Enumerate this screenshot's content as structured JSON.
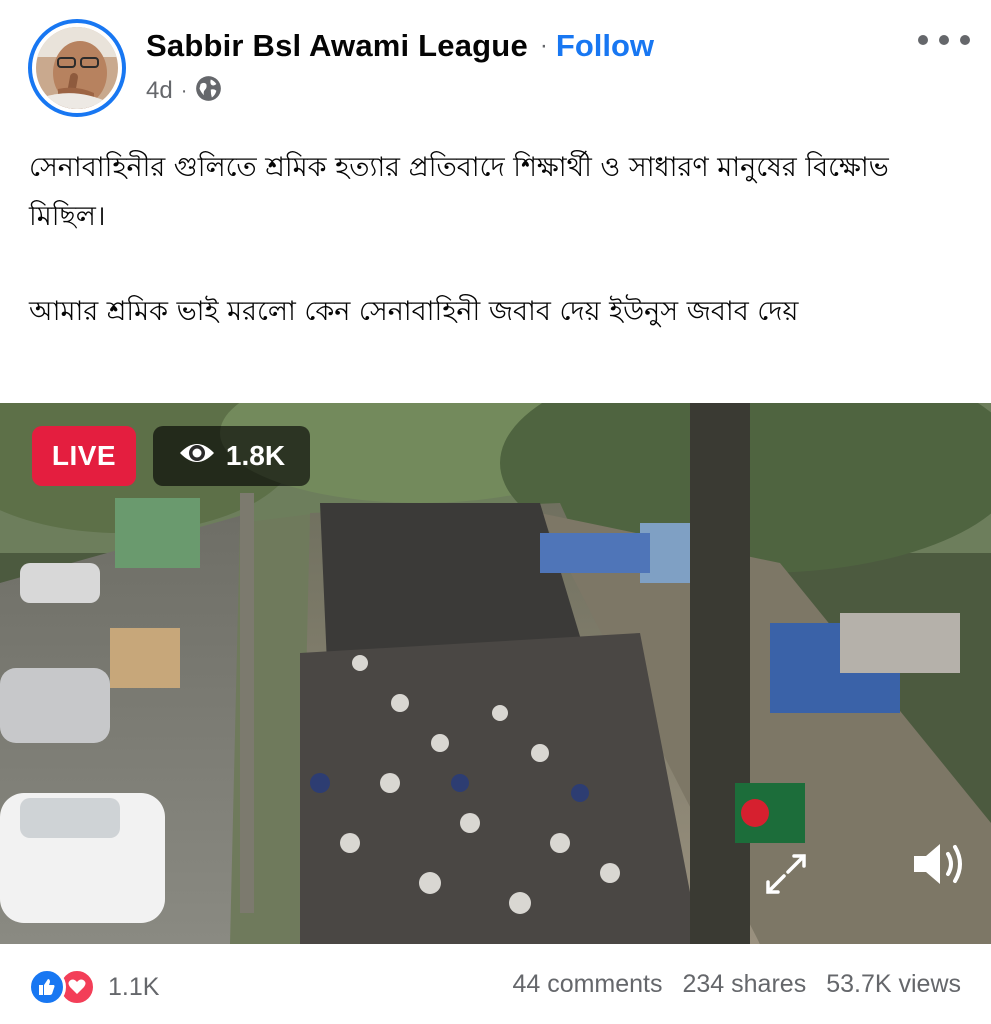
{
  "post": {
    "author": "Sabbir Bsl Awami League",
    "separator": "·",
    "follow_label": "Follow",
    "time": "4d",
    "meta_dot": "·",
    "privacy_icon": "globe-icon",
    "more_icon": "more-horizontal-icon"
  },
  "caption": {
    "line1": "সেনাবাহিনীর গুলিতে শ্রমিক হত্যার প্রতিবাদে  শিক্ষার্থী ও সাধারণ মানুষের বিক্ষোভ মিছিল।",
    "line2": "আমার শ্রমিক ভাই মরলো কেন সেনাবাহিনী জবাব দেয় ইউনুস জবাব দেয়"
  },
  "video": {
    "live_label": "LIVE",
    "viewers": "1.8K",
    "viewer_icon": "eye-icon",
    "sound_icon": "volume-icon",
    "expand_icon": "expand-icon"
  },
  "footer": {
    "reaction_icons": [
      "like-icon",
      "love-icon"
    ],
    "reaction_count": "1.1K",
    "comments": "44 comments",
    "shares": "234 shares",
    "views": "53.7K views"
  },
  "colors": {
    "accent": "#1877f2",
    "live_red": "#e41e3f",
    "love_red": "#f33e58",
    "secondary_text": "#65676b"
  }
}
